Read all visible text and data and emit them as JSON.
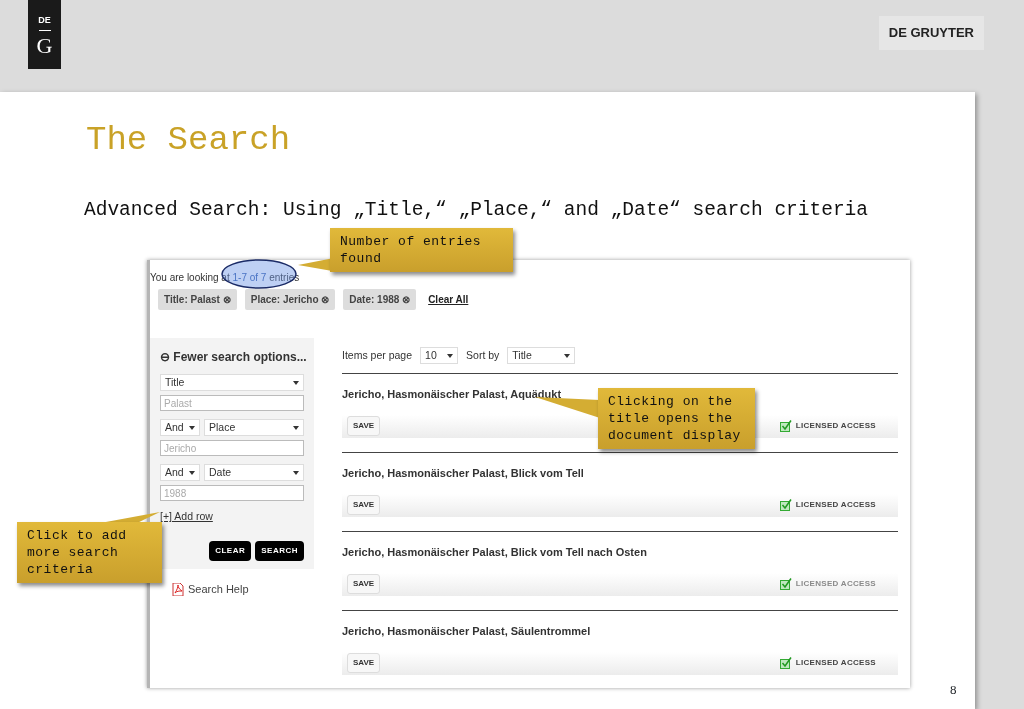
{
  "header": {
    "logo": {
      "top": "DE",
      "bottom": "G"
    },
    "brand": "DE GRUYTER"
  },
  "slide": {
    "title": "The Search",
    "subtitle": "Advanced Search: Using „Title,“ „Place,“ and „Date“ search criteria",
    "page_number": "8"
  },
  "screenshot": {
    "summary": "You are looking at **1-7 of 7** entries",
    "filters": [
      {
        "label": "Title: Palast",
        "remove": "⊗"
      },
      {
        "label": "Place: Jericho",
        "remove": "⊗"
      },
      {
        "label": "Date: 1988",
        "remove": "⊗"
      }
    ],
    "clear_all": "Clear All",
    "search_panel": {
      "toggle": "⊖ Fewer search options...",
      "rows": [
        {
          "field": "Title",
          "placeholder": "Palast"
        },
        {
          "operator": "And",
          "field": "Place",
          "placeholder": "Jericho"
        },
        {
          "operator": "And",
          "field": "Date",
          "placeholder": "1988"
        }
      ],
      "add_row": "[+] Add row",
      "buttons": [
        "CLEAR",
        "SEARCH"
      ],
      "help": "Search Help"
    },
    "toolbar": {
      "items_label": "Items per page",
      "items_value": "10",
      "sort_label": "Sort by",
      "sort_value": "Title"
    },
    "results": [
      {
        "title": "Jericho, Hasmonäischer Palast, Aquädukt",
        "save": "SAVE",
        "access": "LICENSED ACCESS",
        "dimmed": false
      },
      {
        "title": "Jericho, Hasmonäischer Palast, Blick vom Tell",
        "save": "SAVE",
        "access": "LICENSED ACCESS",
        "dimmed": false
      },
      {
        "title": "Jericho, Hasmonäischer Palast, Blick vom Tell nach Osten",
        "save": "SAVE",
        "access": "LICENSED ACCESS",
        "dimmed": true
      },
      {
        "title": "Jericho, Hasmonäischer Palast, Säulentrommel",
        "save": "SAVE",
        "access": "LICENSED ACCESS",
        "dimmed": false
      }
    ]
  },
  "callouts": [
    {
      "text": "Number of entries found"
    },
    {
      "text": "Clicking on the title opens the document display"
    },
    {
      "text": "Click to add more search criteria"
    }
  ]
}
